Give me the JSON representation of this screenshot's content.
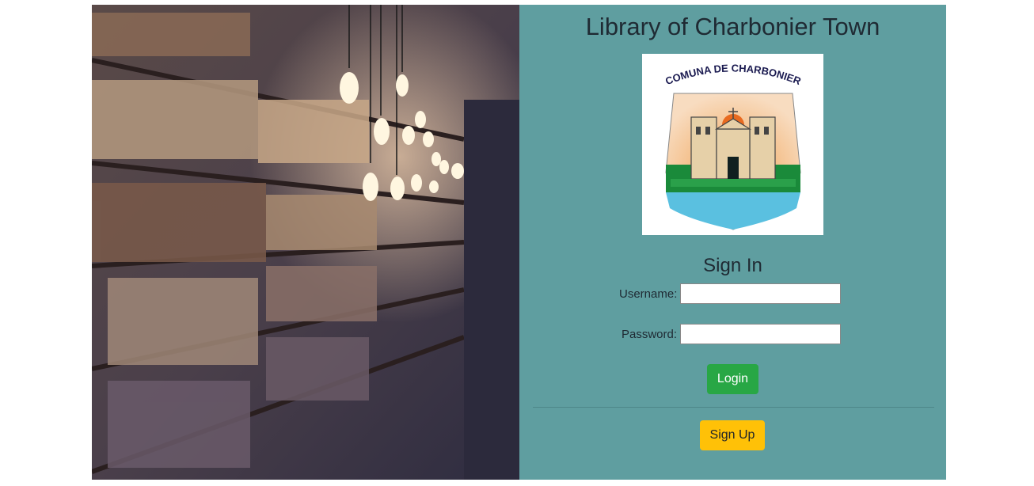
{
  "header": {
    "title": "Library of Charbonier Town"
  },
  "logo": {
    "text": "COMUNA DE CHARBONIER"
  },
  "form": {
    "heading": "Sign In",
    "username_label": "Username:",
    "username_value": "",
    "password_label": "Password:",
    "password_value": "",
    "login_label": "Login",
    "signup_label": "Sign Up"
  },
  "colors": {
    "panel": "#5f9ea0",
    "login_button": "#28a745",
    "signup_button": "#ffc107"
  }
}
